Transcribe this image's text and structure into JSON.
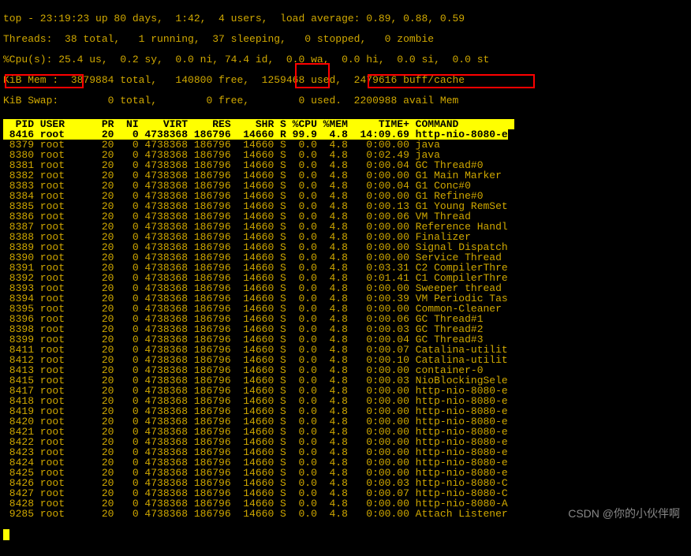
{
  "summary": {
    "line1": "top - 23:19:23 up 80 days,  1:42,  4 users,  load average: 0.89, 0.88, 0.59",
    "line2": "Threads:  38 total,   1 running,  37 sleeping,   0 stopped,   0 zombie",
    "line3": "%Cpu(s): 25.4 us,  0.2 sy,  0.0 ni, 74.4 id,  0.0 wa,  0.0 hi,  0.0 si,  0.0 st",
    "line4": "KiB Mem :  3879884 total,   140800 free,  1259468 used,  2479616 buff/cache",
    "line5": "KiB Swap:        0 total,        0 free,        0 used.  2200988 avail Mem "
  },
  "columns": "  PID USER      PR  NI    VIRT    RES    SHR S %CPU %MEM     TIME+ COMMAND         ",
  "processes": [
    {
      "pid": "8416",
      "user": "root",
      "pr": "20",
      "ni": "0",
      "virt": "4738368",
      "res": "186796",
      "shr": "14660",
      "s": "R",
      "cpu": "99.9",
      "mem": "4.8",
      "time": "14:09.69",
      "cmd": "http-nio-8080-e",
      "hl": true
    },
    {
      "pid": "8379",
      "user": "root",
      "pr": "20",
      "ni": "0",
      "virt": "4738368",
      "res": "186796",
      "shr": "14660",
      "s": "S",
      "cpu": "0.0",
      "mem": "4.8",
      "time": "0:00.00",
      "cmd": "java"
    },
    {
      "pid": "8380",
      "user": "root",
      "pr": "20",
      "ni": "0",
      "virt": "4738368",
      "res": "186796",
      "shr": "14660",
      "s": "S",
      "cpu": "0.0",
      "mem": "4.8",
      "time": "0:02.49",
      "cmd": "java"
    },
    {
      "pid": "8381",
      "user": "root",
      "pr": "20",
      "ni": "0",
      "virt": "4738368",
      "res": "186796",
      "shr": "14660",
      "s": "S",
      "cpu": "0.0",
      "mem": "4.8",
      "time": "0:00.04",
      "cmd": "GC Thread#0"
    },
    {
      "pid": "8382",
      "user": "root",
      "pr": "20",
      "ni": "0",
      "virt": "4738368",
      "res": "186796",
      "shr": "14660",
      "s": "S",
      "cpu": "0.0",
      "mem": "4.8",
      "time": "0:00.00",
      "cmd": "G1 Main Marker"
    },
    {
      "pid": "8383",
      "user": "root",
      "pr": "20",
      "ni": "0",
      "virt": "4738368",
      "res": "186796",
      "shr": "14660",
      "s": "S",
      "cpu": "0.0",
      "mem": "4.8",
      "time": "0:00.04",
      "cmd": "G1 Conc#0"
    },
    {
      "pid": "8384",
      "user": "root",
      "pr": "20",
      "ni": "0",
      "virt": "4738368",
      "res": "186796",
      "shr": "14660",
      "s": "S",
      "cpu": "0.0",
      "mem": "4.8",
      "time": "0:00.00",
      "cmd": "G1 Refine#0"
    },
    {
      "pid": "8385",
      "user": "root",
      "pr": "20",
      "ni": "0",
      "virt": "4738368",
      "res": "186796",
      "shr": "14660",
      "s": "S",
      "cpu": "0.0",
      "mem": "4.8",
      "time": "0:00.13",
      "cmd": "G1 Young RemSet"
    },
    {
      "pid": "8386",
      "user": "root",
      "pr": "20",
      "ni": "0",
      "virt": "4738368",
      "res": "186796",
      "shr": "14660",
      "s": "S",
      "cpu": "0.0",
      "mem": "4.8",
      "time": "0:00.06",
      "cmd": "VM Thread"
    },
    {
      "pid": "8387",
      "user": "root",
      "pr": "20",
      "ni": "0",
      "virt": "4738368",
      "res": "186796",
      "shr": "14660",
      "s": "S",
      "cpu": "0.0",
      "mem": "4.8",
      "time": "0:00.00",
      "cmd": "Reference Handl"
    },
    {
      "pid": "8388",
      "user": "root",
      "pr": "20",
      "ni": "0",
      "virt": "4738368",
      "res": "186796",
      "shr": "14660",
      "s": "S",
      "cpu": "0.0",
      "mem": "4.8",
      "time": "0:00.00",
      "cmd": "Finalizer"
    },
    {
      "pid": "8389",
      "user": "root",
      "pr": "20",
      "ni": "0",
      "virt": "4738368",
      "res": "186796",
      "shr": "14660",
      "s": "S",
      "cpu": "0.0",
      "mem": "4.8",
      "time": "0:00.00",
      "cmd": "Signal Dispatch"
    },
    {
      "pid": "8390",
      "user": "root",
      "pr": "20",
      "ni": "0",
      "virt": "4738368",
      "res": "186796",
      "shr": "14660",
      "s": "S",
      "cpu": "0.0",
      "mem": "4.8",
      "time": "0:00.00",
      "cmd": "Service Thread"
    },
    {
      "pid": "8391",
      "user": "root",
      "pr": "20",
      "ni": "0",
      "virt": "4738368",
      "res": "186796",
      "shr": "14660",
      "s": "S",
      "cpu": "0.0",
      "mem": "4.8",
      "time": "0:03.31",
      "cmd": "C2 CompilerThre"
    },
    {
      "pid": "8392",
      "user": "root",
      "pr": "20",
      "ni": "0",
      "virt": "4738368",
      "res": "186796",
      "shr": "14660",
      "s": "S",
      "cpu": "0.0",
      "mem": "4.8",
      "time": "0:01.41",
      "cmd": "C1 CompilerThre"
    },
    {
      "pid": "8393",
      "user": "root",
      "pr": "20",
      "ni": "0",
      "virt": "4738368",
      "res": "186796",
      "shr": "14660",
      "s": "S",
      "cpu": "0.0",
      "mem": "4.8",
      "time": "0:00.00",
      "cmd": "Sweeper thread"
    },
    {
      "pid": "8394",
      "user": "root",
      "pr": "20",
      "ni": "0",
      "virt": "4738368",
      "res": "186796",
      "shr": "14660",
      "s": "S",
      "cpu": "0.0",
      "mem": "4.8",
      "time": "0:00.39",
      "cmd": "VM Periodic Tas"
    },
    {
      "pid": "8395",
      "user": "root",
      "pr": "20",
      "ni": "0",
      "virt": "4738368",
      "res": "186796",
      "shr": "14660",
      "s": "S",
      "cpu": "0.0",
      "mem": "4.8",
      "time": "0:00.00",
      "cmd": "Common-Cleaner"
    },
    {
      "pid": "8396",
      "user": "root",
      "pr": "20",
      "ni": "0",
      "virt": "4738368",
      "res": "186796",
      "shr": "14660",
      "s": "S",
      "cpu": "0.0",
      "mem": "4.8",
      "time": "0:00.06",
      "cmd": "GC Thread#1"
    },
    {
      "pid": "8398",
      "user": "root",
      "pr": "20",
      "ni": "0",
      "virt": "4738368",
      "res": "186796",
      "shr": "14660",
      "s": "S",
      "cpu": "0.0",
      "mem": "4.8",
      "time": "0:00.03",
      "cmd": "GC Thread#2"
    },
    {
      "pid": "8399",
      "user": "root",
      "pr": "20",
      "ni": "0",
      "virt": "4738368",
      "res": "186796",
      "shr": "14660",
      "s": "S",
      "cpu": "0.0",
      "mem": "4.8",
      "time": "0:00.04",
      "cmd": "GC Thread#3"
    },
    {
      "pid": "8411",
      "user": "root",
      "pr": "20",
      "ni": "0",
      "virt": "4738368",
      "res": "186796",
      "shr": "14660",
      "s": "S",
      "cpu": "0.0",
      "mem": "4.8",
      "time": "0:00.07",
      "cmd": "Catalina-utilit"
    },
    {
      "pid": "8412",
      "user": "root",
      "pr": "20",
      "ni": "0",
      "virt": "4738368",
      "res": "186796",
      "shr": "14660",
      "s": "S",
      "cpu": "0.0",
      "mem": "4.8",
      "time": "0:00.10",
      "cmd": "Catalina-utilit"
    },
    {
      "pid": "8413",
      "user": "root",
      "pr": "20",
      "ni": "0",
      "virt": "4738368",
      "res": "186796",
      "shr": "14660",
      "s": "S",
      "cpu": "0.0",
      "mem": "4.8",
      "time": "0:00.00",
      "cmd": "container-0"
    },
    {
      "pid": "8415",
      "user": "root",
      "pr": "20",
      "ni": "0",
      "virt": "4738368",
      "res": "186796",
      "shr": "14660",
      "s": "S",
      "cpu": "0.0",
      "mem": "4.8",
      "time": "0:00.03",
      "cmd": "NioBlockingSele"
    },
    {
      "pid": "8417",
      "user": "root",
      "pr": "20",
      "ni": "0",
      "virt": "4738368",
      "res": "186796",
      "shr": "14660",
      "s": "S",
      "cpu": "0.0",
      "mem": "4.8",
      "time": "0:00.00",
      "cmd": "http-nio-8080-e"
    },
    {
      "pid": "8418",
      "user": "root",
      "pr": "20",
      "ni": "0",
      "virt": "4738368",
      "res": "186796",
      "shr": "14660",
      "s": "S",
      "cpu": "0.0",
      "mem": "4.8",
      "time": "0:00.00",
      "cmd": "http-nio-8080-e"
    },
    {
      "pid": "8419",
      "user": "root",
      "pr": "20",
      "ni": "0",
      "virt": "4738368",
      "res": "186796",
      "shr": "14660",
      "s": "S",
      "cpu": "0.0",
      "mem": "4.8",
      "time": "0:00.00",
      "cmd": "http-nio-8080-e"
    },
    {
      "pid": "8420",
      "user": "root",
      "pr": "20",
      "ni": "0",
      "virt": "4738368",
      "res": "186796",
      "shr": "14660",
      "s": "S",
      "cpu": "0.0",
      "mem": "4.8",
      "time": "0:00.00",
      "cmd": "http-nio-8080-e"
    },
    {
      "pid": "8421",
      "user": "root",
      "pr": "20",
      "ni": "0",
      "virt": "4738368",
      "res": "186796",
      "shr": "14660",
      "s": "S",
      "cpu": "0.0",
      "mem": "4.8",
      "time": "0:00.00",
      "cmd": "http-nio-8080-e"
    },
    {
      "pid": "8422",
      "user": "root",
      "pr": "20",
      "ni": "0",
      "virt": "4738368",
      "res": "186796",
      "shr": "14660",
      "s": "S",
      "cpu": "0.0",
      "mem": "4.8",
      "time": "0:00.00",
      "cmd": "http-nio-8080-e"
    },
    {
      "pid": "8423",
      "user": "root",
      "pr": "20",
      "ni": "0",
      "virt": "4738368",
      "res": "186796",
      "shr": "14660",
      "s": "S",
      "cpu": "0.0",
      "mem": "4.8",
      "time": "0:00.00",
      "cmd": "http-nio-8080-e"
    },
    {
      "pid": "8424",
      "user": "root",
      "pr": "20",
      "ni": "0",
      "virt": "4738368",
      "res": "186796",
      "shr": "14660",
      "s": "S",
      "cpu": "0.0",
      "mem": "4.8",
      "time": "0:00.00",
      "cmd": "http-nio-8080-e"
    },
    {
      "pid": "8425",
      "user": "root",
      "pr": "20",
      "ni": "0",
      "virt": "4738368",
      "res": "186796",
      "shr": "14660",
      "s": "S",
      "cpu": "0.0",
      "mem": "4.8",
      "time": "0:00.00",
      "cmd": "http-nio-8080-e"
    },
    {
      "pid": "8426",
      "user": "root",
      "pr": "20",
      "ni": "0",
      "virt": "4738368",
      "res": "186796",
      "shr": "14660",
      "s": "S",
      "cpu": "0.0",
      "mem": "4.8",
      "time": "0:00.03",
      "cmd": "http-nio-8080-C"
    },
    {
      "pid": "8427",
      "user": "root",
      "pr": "20",
      "ni": "0",
      "virt": "4738368",
      "res": "186796",
      "shr": "14660",
      "s": "S",
      "cpu": "0.0",
      "mem": "4.8",
      "time": "0:00.07",
      "cmd": "http-nio-8080-C"
    },
    {
      "pid": "8428",
      "user": "root",
      "pr": "20",
      "ni": "0",
      "virt": "4738368",
      "res": "186796",
      "shr": "14660",
      "s": "S",
      "cpu": "0.0",
      "mem": "4.8",
      "time": "0:00.00",
      "cmd": "http-nio-8080-A"
    },
    {
      "pid": "9285",
      "user": "root",
      "pr": "20",
      "ni": "0",
      "virt": "4738368",
      "res": "186796",
      "shr": "14660",
      "s": "S",
      "cpu": "0.0",
      "mem": "4.8",
      "time": "0:00.00",
      "cmd": "Attach Listener"
    }
  ],
  "watermark": "CSDN @你的小伙伴啊"
}
